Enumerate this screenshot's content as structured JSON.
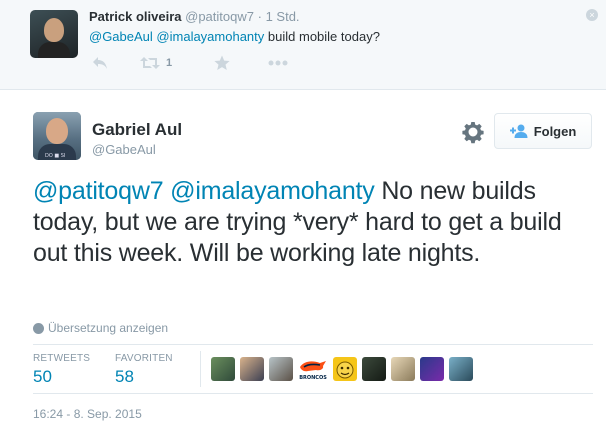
{
  "reply_context": {
    "name": "Patrick oliveira",
    "handle": "@patitoqw7",
    "separator": "·",
    "time": "1 Std.",
    "mention_1": "@GabeAul",
    "mention_2": "@imalayamohanty",
    "text_rest": "build mobile today?",
    "retweet_count": "1",
    "close_icon_glyph": "×"
  },
  "tweet": {
    "name": "Gabriel Aul",
    "handle": "@GabeAul",
    "avatar_tag": "DO ■ SI",
    "follow_label": "Folgen",
    "mention_1": "@patitoqw7",
    "mention_2": "@imalayamohanty",
    "text_rest": "No new builds today, but we are trying *very* hard to get a build out this week. Will be working late nights.",
    "translate_label": "Übersetzung anzeigen",
    "retweets_label": "RETWEETS",
    "retweets_count": "50",
    "favorites_label": "FAVORITEN",
    "favorites_count": "58",
    "favoriter_broncos_label": "BRONCOS",
    "timestamp": "16:24 - 8. Sep. 2015"
  },
  "colors": {
    "link": "#0084b4",
    "text": "#292f33",
    "muted": "#8899a6",
    "border": "#e1e8ed",
    "context_bg": "#f5f8fa"
  },
  "icons": {
    "reply": "reply-icon",
    "retweet": "retweet-icon",
    "favorite": "star-icon",
    "more": "more-dots-icon",
    "close": "close-icon",
    "settings": "gear-icon",
    "follow": "add-user-icon",
    "translate": "globe-icon"
  }
}
